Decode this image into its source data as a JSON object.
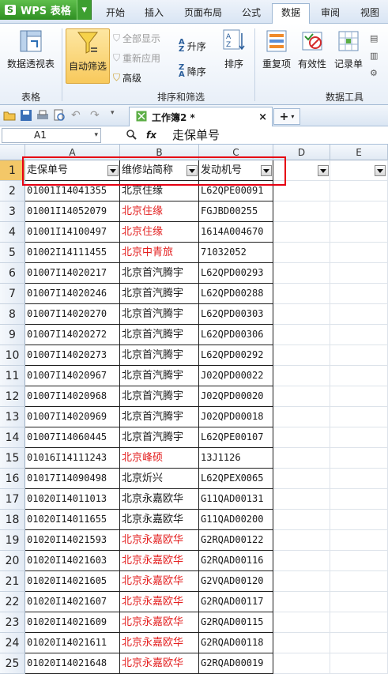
{
  "app": {
    "name": "WPS 表格",
    "menu_tabs": [
      "开始",
      "插入",
      "页面布局",
      "公式",
      "数据",
      "审阅",
      "视图"
    ],
    "active_tab": "数据"
  },
  "ribbon": {
    "pivot": "数据透视表",
    "autofilter": "自动筛选",
    "show_all": "全部显示",
    "reapply": "重新应用",
    "advanced": "高级",
    "sort_asc": "升序",
    "sort_desc": "降序",
    "sort": "排序",
    "duplicates": "重复项",
    "validity": "有效性",
    "record_list": "记录单",
    "group_table": "表格",
    "group_sort_filter": "排序和筛选",
    "group_data_tools": "数据工具"
  },
  "document_tab": {
    "title": "工作簿2 *",
    "close": "×",
    "new": "+"
  },
  "formula_bar": {
    "cell_ref": "A1",
    "fx": "fx",
    "content": "走保单号"
  },
  "grid": {
    "columns": [
      "A",
      "B",
      "C",
      "D",
      "E"
    ],
    "headers": [
      "走保单号",
      "维修站简称",
      "发动机号"
    ],
    "rows": [
      {
        "n": "2",
        "a": "01001I14041355",
        "b": "北京住缘",
        "c": "L62QPE00091",
        "red": false
      },
      {
        "n": "3",
        "a": "01001I14052079",
        "b": "北京住缘",
        "c": "FGJBD00255",
        "red": true
      },
      {
        "n": "4",
        "a": "01001I14100497",
        "b": "北京住缘",
        "c": "1614A004670",
        "red": true
      },
      {
        "n": "5",
        "a": "01002I14111455",
        "b": "北京中青旅",
        "c": "71032052",
        "red": true
      },
      {
        "n": "6",
        "a": "01007I14020217",
        "b": "北京首汽腾宇",
        "c": "L62QPD00293",
        "red": false
      },
      {
        "n": "7",
        "a": "01007I14020246",
        "b": "北京首汽腾宇",
        "c": "L62QPD00288",
        "red": false
      },
      {
        "n": "8",
        "a": "01007I14020270",
        "b": "北京首汽腾宇",
        "c": "L62QPD00303",
        "red": false
      },
      {
        "n": "9",
        "a": "01007I14020272",
        "b": "北京首汽腾宇",
        "c": "L62QPD00306",
        "red": false
      },
      {
        "n": "10",
        "a": "01007I14020273",
        "b": "北京首汽腾宇",
        "c": "L62QPD00292",
        "red": false
      },
      {
        "n": "11",
        "a": "01007I14020967",
        "b": "北京首汽腾宇",
        "c": "J02QPD00022",
        "red": false
      },
      {
        "n": "12",
        "a": "01007I14020968",
        "b": "北京首汽腾宇",
        "c": "J02QPD00020",
        "red": false
      },
      {
        "n": "13",
        "a": "01007I14020969",
        "b": "北京首汽腾宇",
        "c": "J02QPD00018",
        "red": false
      },
      {
        "n": "14",
        "a": "01007I14060445",
        "b": "北京首汽腾宇",
        "c": "L62QPE00107",
        "red": false
      },
      {
        "n": "15",
        "a": "01016I14111243",
        "b": "北京峰硕",
        "c": "13J1126",
        "red": true
      },
      {
        "n": "16",
        "a": "01017I14090498",
        "b": "北京炘兴",
        "c": "L62QPEX0065",
        "red": false
      },
      {
        "n": "17",
        "a": "01020I14011013",
        "b": "北京永嘉欧华",
        "c": "G11QAD00131",
        "red": false
      },
      {
        "n": "18",
        "a": "01020I14011655",
        "b": "北京永嘉欧华",
        "c": "G11QAD00200",
        "red": false
      },
      {
        "n": "19",
        "a": "01020I14021593",
        "b": "北京永嘉欧华",
        "c": "G2RQAD00122",
        "red": true
      },
      {
        "n": "20",
        "a": "01020I14021603",
        "b": "北京永嘉欧华",
        "c": "G2RQAD00116",
        "red": true
      },
      {
        "n": "21",
        "a": "01020I14021605",
        "b": "北京永嘉欧华",
        "c": "G2VQAD00120",
        "red": true
      },
      {
        "n": "22",
        "a": "01020I14021607",
        "b": "北京永嘉欧华",
        "c": "G2RQAD00117",
        "red": true
      },
      {
        "n": "23",
        "a": "01020I14021609",
        "b": "北京永嘉欧华",
        "c": "G2RQAD00115",
        "red": true
      },
      {
        "n": "24",
        "a": "01020I14021611",
        "b": "北京永嘉欧华",
        "c": "G2RQAD00118",
        "red": true
      },
      {
        "n": "25",
        "a": "01020I14021648",
        "b": "北京永嘉欧华",
        "c": "G2RQAD00019",
        "red": true
      }
    ]
  },
  "colors": {
    "wps_green": "#2e8e22",
    "highlight_red": "#e60012",
    "red_text": "#e32020",
    "selected_row": "#f3c768"
  }
}
